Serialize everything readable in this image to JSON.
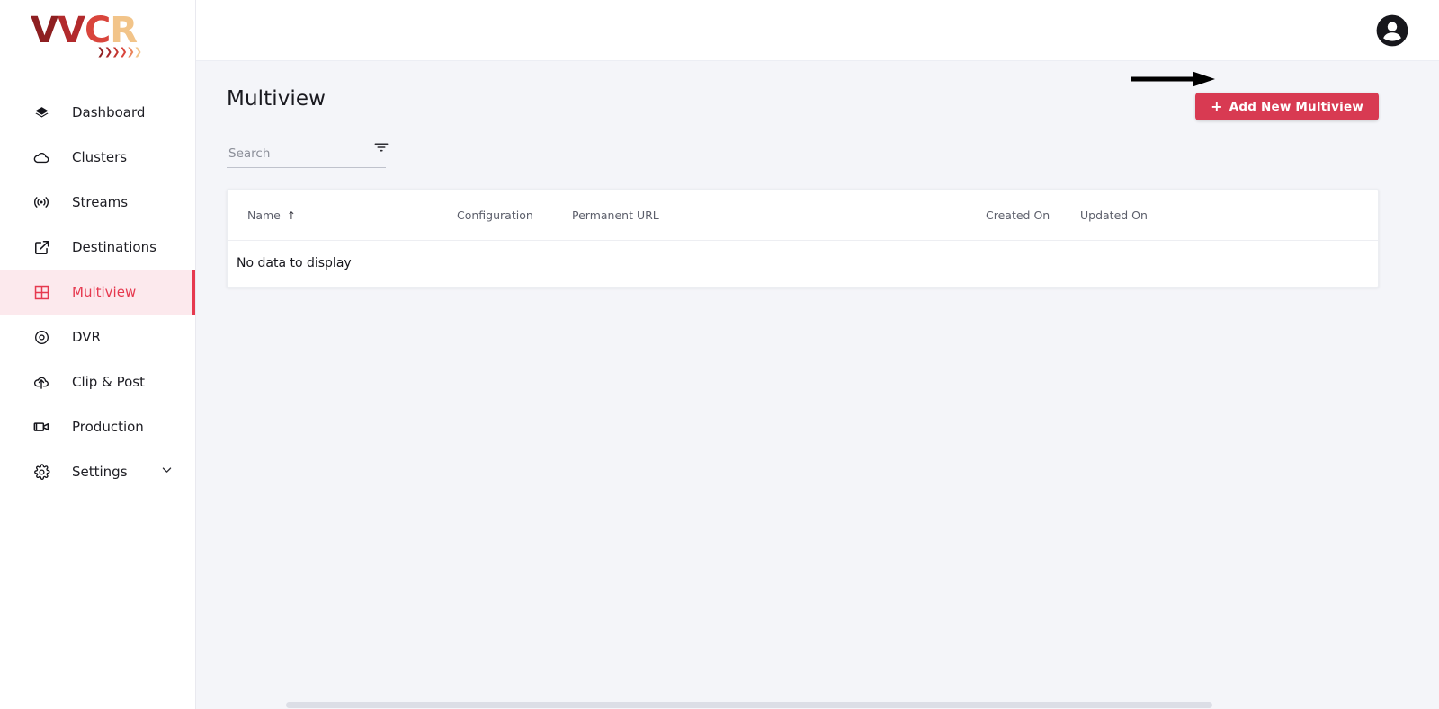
{
  "brand": {
    "logo_letters": [
      {
        "char": "V",
        "color": "#8e1f21"
      },
      {
        "char": "V",
        "color": "#b22a2c"
      },
      {
        "char": "C",
        "color": "#d9453c"
      },
      {
        "char": "R",
        "color": "#f2c489"
      }
    ],
    "chevrons": [
      {
        "char": "❯",
        "color": "#8e1f21"
      },
      {
        "char": "❯",
        "color": "#a9262a"
      },
      {
        "char": "❯",
        "color": "#c33530"
      },
      {
        "char": "❯",
        "color": "#d9453c"
      },
      {
        "char": "❯",
        "color": "#e9835a"
      },
      {
        "char": "❯",
        "color": "#f2c489"
      }
    ]
  },
  "sidebar": {
    "items": [
      {
        "label": "Dashboard",
        "icon": "layers-icon",
        "active": false,
        "expandable": false
      },
      {
        "label": "Clusters",
        "icon": "cloud-icon",
        "active": false,
        "expandable": false
      },
      {
        "label": "Streams",
        "icon": "broadcast-icon",
        "active": false,
        "expandable": false
      },
      {
        "label": "Destinations",
        "icon": "external-link-icon",
        "active": false,
        "expandable": false
      },
      {
        "label": "Multiview",
        "icon": "grid-icon",
        "active": true,
        "expandable": false
      },
      {
        "label": "DVR",
        "icon": "record-circle-icon",
        "active": false,
        "expandable": false
      },
      {
        "label": "Clip & Post",
        "icon": "cloud-upload-icon",
        "active": false,
        "expandable": false
      },
      {
        "label": "Production",
        "icon": "video-camera-icon",
        "active": false,
        "expandable": false
      },
      {
        "label": "Settings",
        "icon": "gear-icon",
        "active": false,
        "expandable": true
      }
    ],
    "active_accent": "#e6394f",
    "active_background": "#fce9ed"
  },
  "topbar": {
    "account_icon": "account-circle-icon"
  },
  "page": {
    "title": "Multiview",
    "add_button_label": "Add New Multiview",
    "add_button_plus": "+",
    "add_button_color": "#d83a52"
  },
  "search": {
    "placeholder": "Search",
    "value": "",
    "filter_icon": "filter-icon"
  },
  "table": {
    "columns": [
      {
        "label": "Name",
        "sorted": true,
        "sort_arrow": "↑"
      },
      {
        "label": "Configuration",
        "sorted": false
      },
      {
        "label": "Permanent URL",
        "sorted": false
      },
      {
        "label": "Created On",
        "sorted": false
      },
      {
        "label": "Updated On",
        "sorted": false
      }
    ],
    "empty_message": "No data to display",
    "rows": []
  },
  "annotation": {
    "type": "arrow",
    "direction": "right",
    "color": "#000000",
    "points_to": "Add New Multiview"
  }
}
